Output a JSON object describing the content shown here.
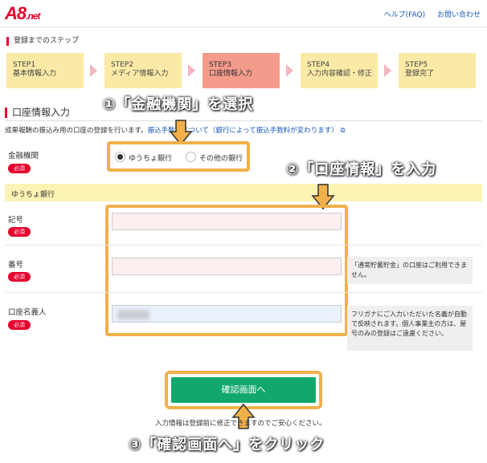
{
  "header": {
    "logo": "A8",
    "logo_suffix": ".net",
    "links": [
      "ヘルプ(FAQ)",
      "お問い合わせ"
    ]
  },
  "steps_title": "登録までのステップ",
  "steps": [
    {
      "name": "STEP1",
      "label": "基本情報入力"
    },
    {
      "name": "STEP2",
      "label": "メディア情報入力"
    },
    {
      "name": "STEP3",
      "label": "口座情報入力",
      "active": true
    },
    {
      "name": "STEP4",
      "label": "入力内容確認・修正"
    },
    {
      "name": "STEP5",
      "label": "登録完了"
    }
  ],
  "annotations": {
    "a1": "①「金融機関」を選択",
    "a2": "②「口座情報」を入力",
    "a3": "③「確認画面へ」をクリック"
  },
  "section": {
    "title": "口座情報入力",
    "desc_prefix": "成果報酬の振込み用の口座の登録を行います。",
    "desc_link": "振込手数料について（銀行によって振込手数料が変わります）"
  },
  "form": {
    "bank_label": "金融機関",
    "required": "必須",
    "radio_options": [
      "ゆうちょ銀行",
      "その他の銀行"
    ],
    "bank_band": "ゆうちょ銀行",
    "kigo_label": "記号",
    "bango_label": "番号",
    "meigi_label": "口座名義人",
    "kigo_value": "",
    "bango_value": "",
    "meigi_value": ""
  },
  "notes": {
    "bango": "「通常貯蓄貯金」の口座はご利用できません。",
    "meigi": "フリガナにご入力いただいた名義が自動で反映されます。個人事業主の方は、屋号のみの登録はご遠慮ください。"
  },
  "confirm_button": "確認画面へ",
  "footer_note": "入力情報は登録前に修正できますのでご安心ください。",
  "colors": {
    "brand": "#e4002b",
    "highlight": "#f2b04a",
    "step": "#fbeaa6",
    "step_active": "#f59b8b",
    "button": "#12a86c"
  }
}
